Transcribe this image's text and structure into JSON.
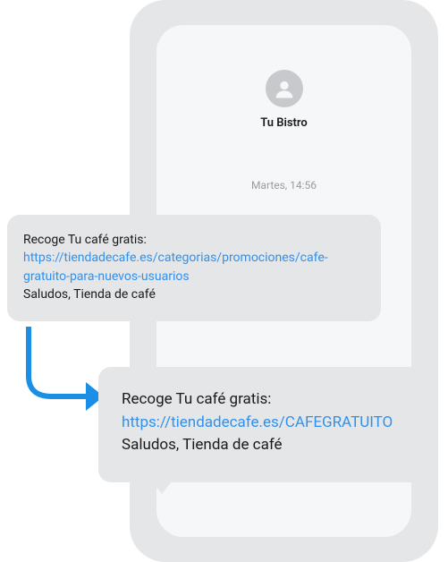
{
  "contact": {
    "name": "Tu Bistro"
  },
  "timestamp": "Martes, 14:56",
  "message1": {
    "line1": "Recoge Tu café gratis:",
    "url": "https://tiendadecafe.es/categorias/promociones/cafe-gratuito-para-nuevos-usuarios",
    "signature": "Saludos, Tienda de café"
  },
  "message2": {
    "line1": "Recoge Tu café gratis:",
    "url": "https://tiendadecafe.es/CAFEGRATUITO",
    "signature": "Saludos, Tienda de café"
  }
}
